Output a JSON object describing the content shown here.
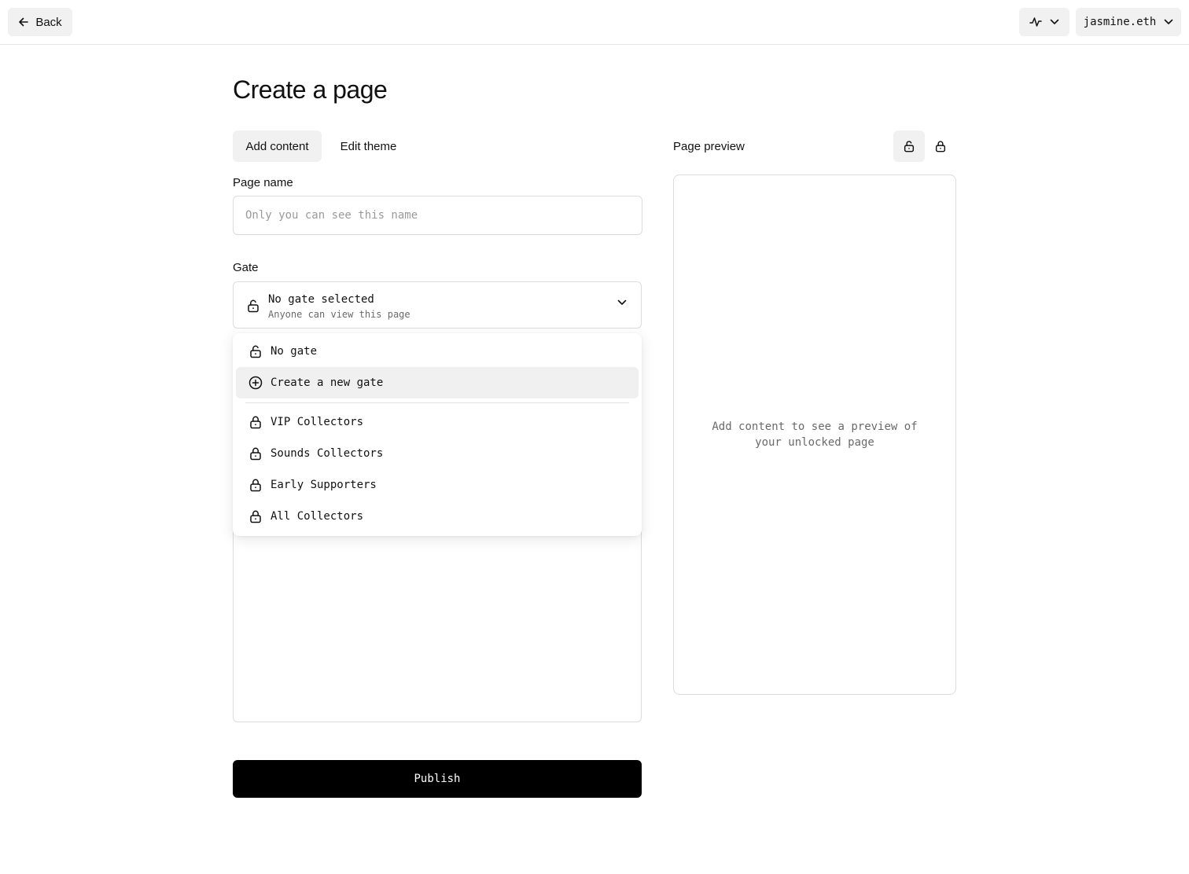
{
  "topbar": {
    "back_label": "Back",
    "back_icon": "arrow-left-icon",
    "activity_icon": "activity-icon",
    "account_name": "jasmine.eth"
  },
  "page": {
    "title": "Create a page"
  },
  "tabs": [
    {
      "label": "Add content",
      "active": true
    },
    {
      "label": "Edit theme",
      "active": false
    }
  ],
  "form": {
    "page_name_label": "Page name",
    "page_name_placeholder": "Only you can see this name",
    "page_name_value": "",
    "gate_label": "Gate",
    "gate_selected_title": "No gate selected",
    "gate_selected_sub": "Anyone can view this page"
  },
  "dropdown": {
    "items": [
      {
        "label": "No gate",
        "icon": "unlock-icon"
      },
      {
        "label": "Create a new gate",
        "icon": "plus-circle-icon",
        "highlighted": true
      },
      {
        "label": "VIP Collectors",
        "icon": "lock-icon"
      },
      {
        "label": "Sounds Collectors",
        "icon": "lock-icon"
      },
      {
        "label": "Early Supporters",
        "icon": "lock-icon"
      },
      {
        "label": "All Collectors",
        "icon": "lock-icon"
      }
    ]
  },
  "publish_label": "Publish",
  "preview": {
    "label": "Page preview",
    "empty_text": "Add content to see a preview of your unlocked page"
  },
  "colors": {
    "primary": "#000000",
    "surface": "#f1f1f1",
    "border": "#dcdcdc"
  }
}
